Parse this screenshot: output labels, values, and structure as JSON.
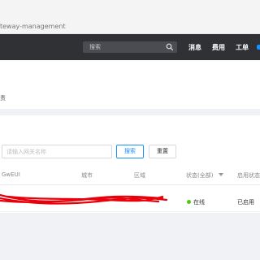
{
  "browser": {
    "url_fragment": "teway-management"
  },
  "topnav": {
    "search_placeholder": "搜索",
    "items": [
      "消息",
      "费用",
      "工单"
    ],
    "accent": "#1890ff"
  },
  "breadcrumb": {
    "fragment": "责"
  },
  "filter": {
    "input_placeholder": "请输入网关名称",
    "search_label": "搜索",
    "reset_label": "重置"
  },
  "table": {
    "columns": [
      "GwEUI",
      "城市",
      "区域",
      "状态(全部)",
      "启用状态"
    ],
    "columns_visible": [
      "GwEUI",
      "城市",
      "区域",
      "状态(全部)",
      "启用状态"
    ],
    "rows": [
      {
        "gweui": "",
        "city": "",
        "region": "",
        "status": "在线",
        "enabled": "已启用"
      }
    ],
    "status_color": "#52c41a"
  }
}
